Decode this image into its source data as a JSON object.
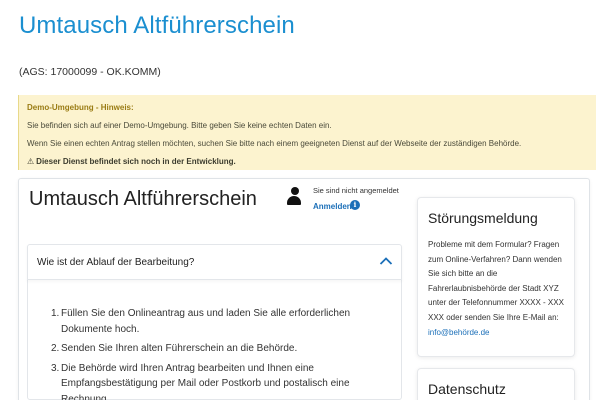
{
  "header": {
    "title": "Umtausch Altführerschein",
    "ags": "(AGS: 17000099 - OK.KOMM)"
  },
  "demo_notice": {
    "heading": "Demo-Umgebung - Hinweis:",
    "line1": "Sie befinden sich auf einer Demo-Umgebung. Bitte geben Sie keine echten Daten ein.",
    "line2": "Wenn Sie einen echten Antrag stellen möchten, suchen Sie bitte nach einem geeigneten Dienst auf der Webseite der zuständigen Behörde.",
    "warning": "Dieser Dienst befindet sich noch in der Entwicklung."
  },
  "main": {
    "title": "Umtausch Altführerschein",
    "login_status": "Sie sind nicht angemeldet",
    "login_link": "Anmelden"
  },
  "accordion": {
    "title": "Wie ist der Ablauf der Bearbeitung?",
    "steps": [
      {
        "num": "1.",
        "text": "Füllen Sie den Onlineantrag aus und laden Sie alle erforderlichen Dokumente hoch."
      },
      {
        "num": "2.",
        "text": "Senden Sie Ihren alten Führerschein an die Behörde."
      },
      {
        "num": "3.",
        "text": "Die Behörde wird Ihren Antrag bearbeiten und Ihnen eine Empfangsbestätigung per Mail oder Postkorb und postalisch eine Rechnung"
      }
    ]
  },
  "sidebar": {
    "fault_title": "Störungsmeldung",
    "fault_text": "Probleme mit dem Formular? Fragen zum Online-Verfahren? Dann wenden Sie sich bitte an die Fahrerlaubnisbehörde der Stadt XYZ unter der Telefonnummer XXXX - XXX XXX oder senden Sie Ihre E-Mail an: ",
    "fault_email": "info@behörde.de",
    "privacy_title": "Datenschutz"
  },
  "colors": {
    "title_blue": "#1b8fd0",
    "link_blue": "#1b6fb8",
    "notice_bg": "#fcf3cf"
  }
}
